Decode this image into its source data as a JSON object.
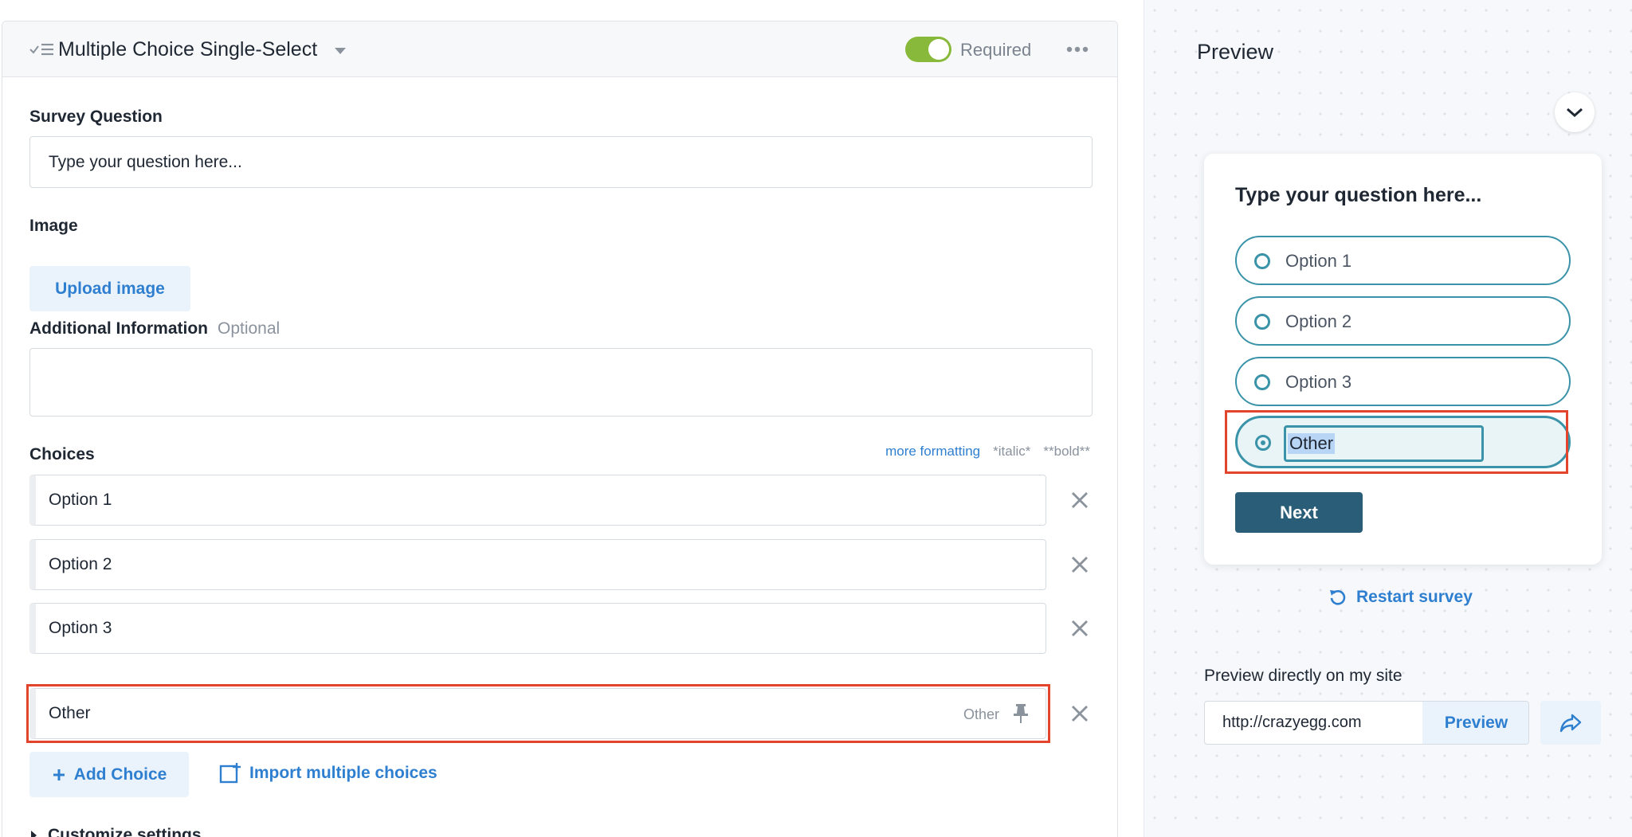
{
  "header": {
    "question_type": "Multiple Choice Single-Select",
    "type_icon": "checklist-icon",
    "required_label": "Required",
    "required_on": true,
    "more_icon": "more-horizontal-icon"
  },
  "form": {
    "survey_question_label": "Survey Question",
    "survey_question_placeholder": "Type your question here...",
    "image_label": "Image",
    "upload_button": "Upload image",
    "additional_info_label": "Additional Information",
    "additional_info_optional": "Optional",
    "additional_info_value": "",
    "formatting": {
      "more_link": "more formatting",
      "italic_hint": "*italic*",
      "bold_hint": "**bold**"
    },
    "choices_label": "Choices",
    "choices": [
      {
        "label": "Option 1"
      },
      {
        "label": "Option 2"
      },
      {
        "label": "Option 3"
      },
      {
        "label": "Other",
        "tag": "Other"
      }
    ],
    "add_choice_button": "Add Choice",
    "import_link": "Import multiple choices",
    "customize_settings": "Customize settings"
  },
  "preview": {
    "title": "Preview",
    "question": "Type your question here...",
    "options": [
      "Option 1",
      "Option 2",
      "Option 3"
    ],
    "other_value": "Other",
    "next_button": "Next",
    "restart_link": "Restart survey",
    "direct_label": "Preview directly on my site",
    "url_value": "http://crazyegg.com",
    "url_preview_button": "Preview"
  },
  "colors": {
    "accent_blue": "#2f7fd0",
    "toggle_green": "#88b93a",
    "highlight_red": "#e2452c",
    "teal": "#3a93a8",
    "next_button": "#2a5d78"
  }
}
